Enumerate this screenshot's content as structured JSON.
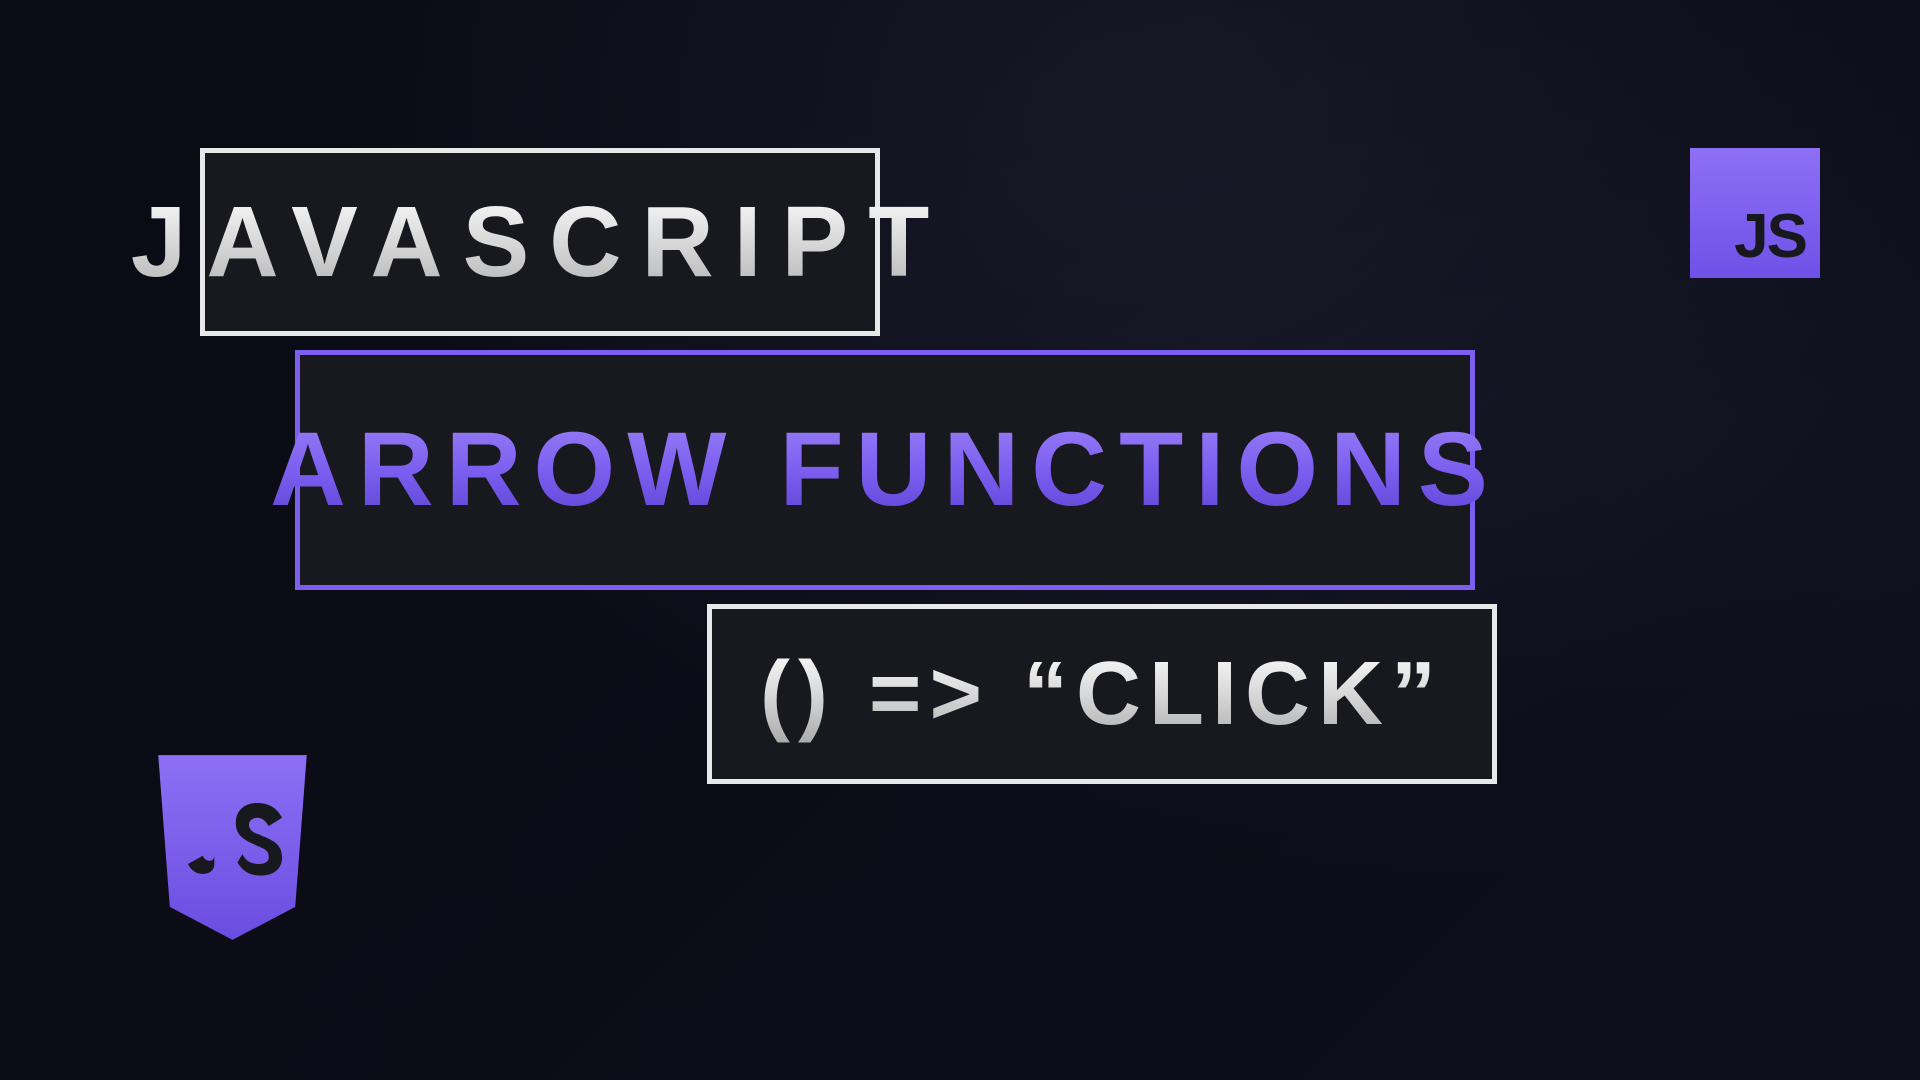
{
  "title_card": {
    "primary": "JAVASCRIPT",
    "secondary": "ARROW FUNCTIONS",
    "code_example": "() => “CLICK”"
  },
  "badges": {
    "square_logo_text": "JS",
    "shield_logo_text": "JS"
  },
  "colors": {
    "accent": "#7c5ff0",
    "accent_light": "#8d70f5",
    "background": "#0a0b14",
    "box_bg": "#18191f",
    "text_light": "#e8e8e8"
  }
}
